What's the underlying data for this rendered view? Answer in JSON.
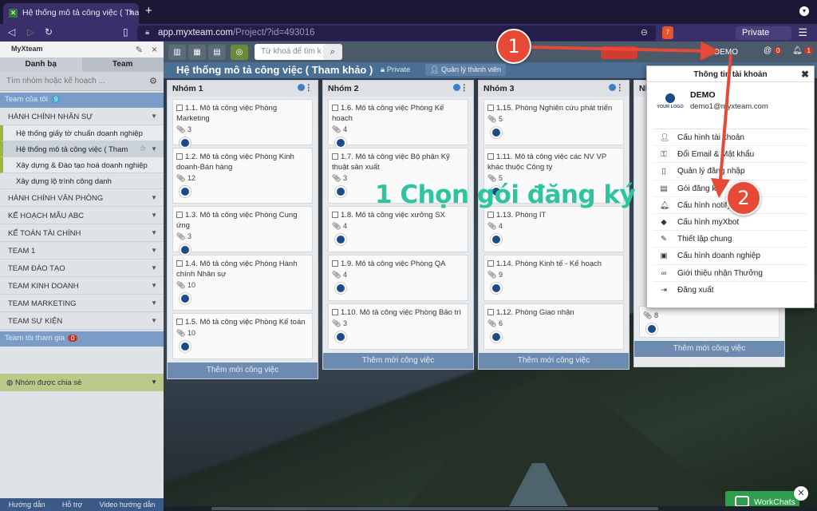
{
  "browser": {
    "tab_title": "Hệ thống mô tả công việc ( Tha",
    "url_host": "app.myxteam.com",
    "url_path": "/Project/?id=493016",
    "brave_count": "7",
    "private_label": "Private"
  },
  "sidebar": {
    "logo": "MyXteam",
    "tabs": [
      "Danh bạ",
      "Team"
    ],
    "search_placeholder": "Tìm nhóm hoặc kế hoạch ...",
    "my_team_label": "Team của tôi",
    "my_team_count": "9",
    "groups": [
      {
        "label": "HÀNH CHÍNH NHÂN SỰ"
      },
      {
        "label": "Hệ thống giấy tờ chuẩn doanh nghiệp"
      },
      {
        "label": "Hệ thống mô tả công việc ( Tham"
      },
      {
        "label": "Xây dựng & Đào tạo hoá doanh nghiệp"
      },
      {
        "label": "Xây dựng lộ trình công danh"
      },
      {
        "label": "HÀNH CHÍNH VĂN PHÒNG"
      },
      {
        "label": "KẾ HOẠCH MẪU ABC"
      },
      {
        "label": "KẾ TOÁN TÀI CHÍNH"
      },
      {
        "label": "TEAM 1"
      },
      {
        "label": "TEAM ĐÀO TẠO"
      },
      {
        "label": "TEAM KINH DOANH"
      },
      {
        "label": "TEAM MARKETING"
      },
      {
        "label": "TEAM SỰ KIỆN"
      }
    ],
    "joined_label": "Team tôi tham gia",
    "joined_count": "0",
    "shared_label": "Nhóm được chia sẻ",
    "footer": [
      "Hướng dẫn",
      "Hỗ trợ",
      "Video hướng dẫn"
    ]
  },
  "toolbar": {
    "search_placeholder": "Từ khoá để tìm k",
    "user_label": "DEMO",
    "msg_count": "0",
    "notif_count": "1"
  },
  "project": {
    "title": "Hệ thống mô tả công việc ( Tham khảo )",
    "privacy": "Private",
    "manage_members": "Quản lý thành viên"
  },
  "columns": [
    {
      "title": "Nhóm 1",
      "cards": [
        {
          "title": "1.1. Mô tả công việc Phòng Marketing",
          "attach": "3"
        },
        {
          "title": "1.2. Mô tả công việc Phòng Kinh doanh-Bán hàng",
          "attach": "12"
        },
        {
          "title": "1.3. Mô tả công việc Phòng Cung ứng",
          "attach": "3"
        },
        {
          "title": "1.4. Mô tả công việc Phòng Hành chính Nhân sự",
          "attach": "10"
        },
        {
          "title": "1.5. Mô tả công việc Phòng Kế toán",
          "attach": "10"
        }
      ]
    },
    {
      "title": "Nhóm 2",
      "cards": [
        {
          "title": "1.6. Mô tả công việc Phòng Kế hoạch",
          "attach": "4"
        },
        {
          "title": "1.7. Mô tả công việc Bộ phận Kỹ thuật sản xuất",
          "attach": "3"
        },
        {
          "title": "1.8. Mô tả công việc xưởng SX",
          "attach": "4"
        },
        {
          "title": "1.9. Mô tả công việc Phòng QA",
          "attach": "4"
        },
        {
          "title": "1.10. Mô tả công việc Phòng Bảo trì",
          "attach": "3"
        }
      ]
    },
    {
      "title": "Nhóm 3",
      "cards": [
        {
          "title": "1.15. Phòng Nghiên cứu phát triển",
          "attach": "5"
        },
        {
          "title": "1.11. Mô tả công việc các NV VP khác thuộc Công ty",
          "attach": "5"
        },
        {
          "title": "1.13. Phòng IT",
          "attach": "4"
        },
        {
          "title": "1.14. Phòng Kinh tế - Kế hoạch",
          "attach": "9"
        },
        {
          "title": "1.12. Phòng Giao nhận",
          "attach": "6"
        }
      ]
    },
    {
      "title": "Nh",
      "cards": [
        {
          "title": "",
          "attach": "8"
        }
      ]
    }
  ],
  "add_task_label": "Thêm mới công việc",
  "popup": {
    "title": "Thông tin tài khoản",
    "name": "DEMO",
    "email": "demo1@myxteam.com",
    "logo_text": "YOUR LOGO",
    "items": [
      {
        "label": "Cấu hình tài khoản",
        "icon": "user-icon"
      },
      {
        "label": "Đổi Email & Mật khẩu",
        "icon": "key-icon"
      },
      {
        "label": "Quản lý đăng nhập",
        "icon": "phone-icon"
      },
      {
        "label": "Gói đăng kí",
        "icon": "document-icon"
      },
      {
        "label": "Cấu hình notify",
        "icon": "bell-icon"
      },
      {
        "label": "Cấu hình myXbot",
        "icon": "android-icon"
      },
      {
        "label": "Thiết lập chung",
        "icon": "wrench-icon"
      },
      {
        "label": "Cấu hình doanh nghiệp",
        "icon": "briefcase-icon"
      },
      {
        "label": "Giới thiệu nhận Thưởng",
        "icon": "link-icon"
      },
      {
        "label": "Đăng xuất",
        "icon": "logout-icon"
      }
    ]
  },
  "annotation": {
    "text": "1 Chọn gói đăng ký",
    "step1": "1",
    "step2": "2",
    "color": "#e64a36"
  },
  "chat": {
    "label": "WorkChats"
  }
}
